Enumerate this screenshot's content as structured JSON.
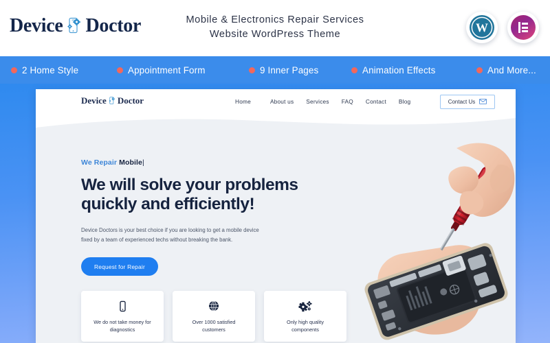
{
  "header": {
    "brand_left": "Device",
    "brand_right": "Doctor",
    "tagline_line1": "Mobile & Electronics Repair Services",
    "tagline_line2": "Website WordPress Theme",
    "badges": [
      {
        "name": "wordpress-badge",
        "label": "WordPress"
      },
      {
        "name": "elementor-badge",
        "label": "Elementor"
      }
    ]
  },
  "feature_strip": {
    "bg_color": "#3b8ceb",
    "dot_color": "#f2685c",
    "items": [
      {
        "label": "2 Home Style"
      },
      {
        "label": "Appointment Form"
      },
      {
        "label": "9 Inner Pages"
      },
      {
        "label": "Animation Effects"
      },
      {
        "label": "And More..."
      }
    ]
  },
  "preview": {
    "site_logo_left": "Device",
    "site_logo_right": "Doctor",
    "menu": [
      {
        "label": "Home",
        "has_dropdown": true
      },
      {
        "label": "About us",
        "has_dropdown": false
      },
      {
        "label": "Services",
        "has_dropdown": false
      },
      {
        "label": "FAQ",
        "has_dropdown": false
      },
      {
        "label": "Contact",
        "has_dropdown": false
      },
      {
        "label": "Blog",
        "has_dropdown": false
      }
    ],
    "contact_button": "Contact Us",
    "hero": {
      "eyebrow_static": "We Repair",
      "eyebrow_typed": "Mobile",
      "eyebrow_caret": "|",
      "headline_line1": "We will solve your problems",
      "headline_line2": "quickly and efficiently!",
      "lede_line1": "Device Doctors is your best choice if you are looking to get a mobile device",
      "lede_line2": "fixed by a team of experienced techs without breaking the bank.",
      "cta_label": "Request for Repair",
      "photo_alt": "hands repairing disassembled smartphone with red screwdriver"
    },
    "cards": [
      {
        "icon": "mobile-phone-icon",
        "line1": "We do not take money for",
        "line2": "diagnostics"
      },
      {
        "icon": "globe-icon",
        "line1": "Over 1000 satisfied",
        "line2": "customers"
      },
      {
        "icon": "gears-icon",
        "line1": "Only high quality",
        "line2": "components"
      }
    ]
  },
  "colors": {
    "accent_blue": "#1f7ef0",
    "strip_blue": "#3b8ceb",
    "coral": "#f2685c",
    "navy": "#16233f",
    "hero_bg": "#eef1f5"
  }
}
